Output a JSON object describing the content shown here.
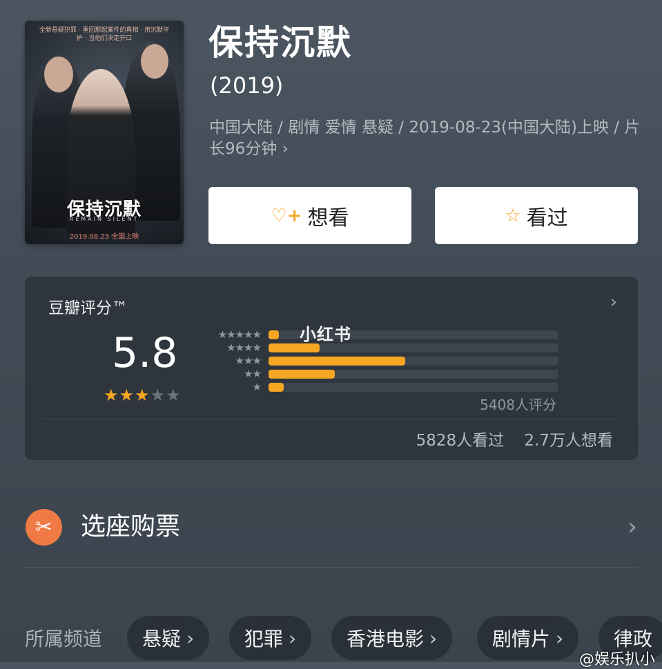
{
  "poster": {
    "tagline": "全新悬疑犯罪 · 重回那起案件的真相 · 用沉默守护 · 当他们决定开口",
    "title": "保持沉默",
    "subtitle": "REMAIN SILENT",
    "date": "2019.08.23  全国上映"
  },
  "movie": {
    "title": "保持沉默",
    "year": "(2019)",
    "meta": "中国大陆 / 剧情 爱情 悬疑 / 2019-08-23(中国大陆)上映 / 片长96分钟",
    "meta_chevron": "›"
  },
  "actions": {
    "want_icon": "heart-plus-icon",
    "want_label": "想看",
    "seen_icon": "star-outline-icon",
    "seen_label": "看过"
  },
  "rating": {
    "label": "豆瓣评分™",
    "score": "5.8",
    "stars_filled": 3,
    "stars_total": 5,
    "distribution": [
      {
        "stars": "★★★★★",
        "value": 0.02
      },
      {
        "stars": "★★★★",
        "value": 0.1
      },
      {
        "stars": "★★★",
        "value": 0.27
      },
      {
        "stars": "★★",
        "value": 0.13
      },
      {
        "stars": "★",
        "value": 0.03
      }
    ],
    "watermark": "小红书",
    "votes": "5408人评分",
    "seen_count": "5828人看过",
    "want_count": "2.7万人想看",
    "arrow": "›"
  },
  "ticket": {
    "icon": "ticket-icon",
    "label": "选座购票",
    "arrow": "›"
  },
  "channels": {
    "label": "所属频道",
    "items": [
      "悬疑",
      "犯罪",
      "香港电影",
      "剧情片",
      "律政"
    ]
  },
  "credit": "@娱乐扒小",
  "colors": {
    "accent": "#f5a623",
    "card": "#2e353d",
    "ticket": "#f07a45"
  }
}
